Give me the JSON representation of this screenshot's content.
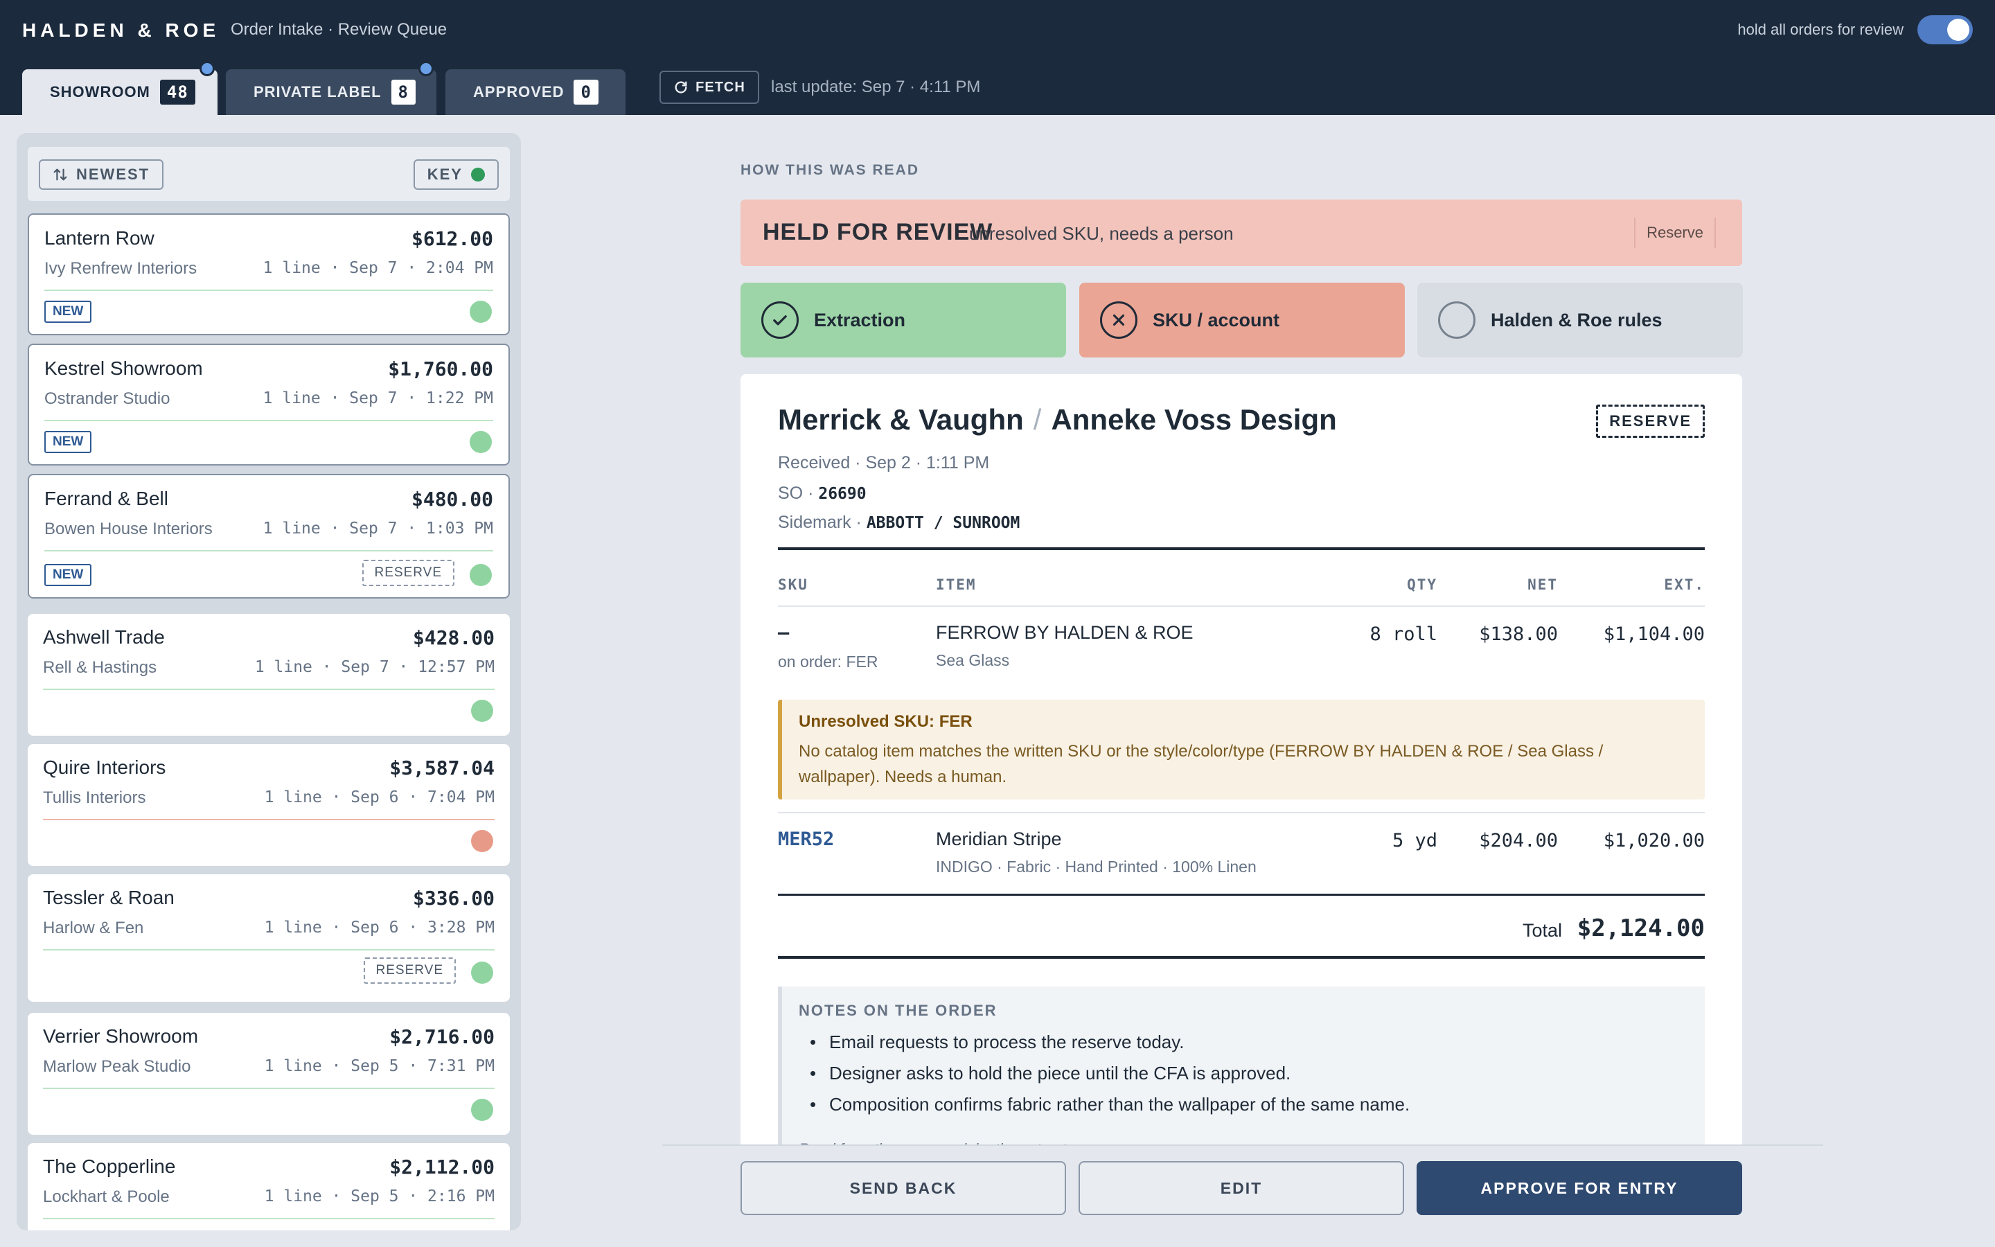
{
  "header": {
    "brand": "HALDEN & ROE",
    "subtitle": "Order Intake · Review Queue",
    "hold_label": "hold all orders for review",
    "hold_enabled": true,
    "tabs": [
      {
        "label": "SHOWROOM",
        "count": "48",
        "active": true,
        "has_dot": true
      },
      {
        "label": "PRIVATE LABEL",
        "count": "8",
        "active": false,
        "has_dot": true
      },
      {
        "label": "APPROVED",
        "count": "0",
        "active": false,
        "has_dot": false
      }
    ],
    "fetch_label": "FETCH",
    "last_update": "last update: Sep 7 · 4:11 PM"
  },
  "sidebar": {
    "sort_label": "NEWEST",
    "key_label": "KEY",
    "cards": [
      {
        "title": "Lantern Row",
        "amount": "$612.00",
        "client": "Ivy Renfrew Interiors",
        "meta": "1 line · Sep 7 · 2:04 PM",
        "badge": "NEW",
        "reserve": "",
        "status": "green"
      },
      {
        "title": "Kestrel Showroom",
        "amount": "$1,760.00",
        "client": "Ostrander Studio",
        "meta": "1 line · Sep 7 · 1:22 PM",
        "badge": "NEW",
        "reserve": "",
        "status": "green"
      },
      {
        "title": "Ferrand & Bell",
        "amount": "$480.00",
        "client": "Bowen House Interiors",
        "meta": "1 line · Sep 7 · 1:03 PM",
        "badge": "NEW",
        "reserve": "RESERVE",
        "status": "green"
      },
      {
        "title": "Ashwell Trade",
        "amount": "$428.00",
        "client": "Rell & Hastings",
        "meta": "1 line · Sep 7 · 12:57 PM",
        "badge": "",
        "reserve": "",
        "status": "green"
      },
      {
        "title": "Quire Interiors",
        "amount": "$3,587.04",
        "client": "Tullis Interiors",
        "meta": "1 line · Sep 6 · 7:04 PM",
        "badge": "",
        "reserve": "",
        "status": "red"
      },
      {
        "title": "Tessler & Roan",
        "amount": "$336.00",
        "client": "Harlow & Fen",
        "meta": "1 line · Sep 6 · 3:28 PM",
        "badge": "",
        "reserve": "RESERVE",
        "status": "green"
      },
      {
        "title": "Verrier Showroom",
        "amount": "$2,716.00",
        "client": "Marlow Peak Studio",
        "meta": "1 line · Sep 5 · 7:31 PM",
        "badge": "",
        "reserve": "",
        "status": "green"
      },
      {
        "title": "The Copperline",
        "amount": "$2,112.00",
        "client": "Lockhart & Poole",
        "meta": "1 line · Sep 5 · 2:16 PM",
        "badge": "",
        "reserve": "",
        "status": "green"
      }
    ]
  },
  "main": {
    "section_label": "HOW THIS WAS READ",
    "held": {
      "title": "HELD FOR REVIEW",
      "reason": "unresolved SKU, needs a person",
      "reserve": "Reserve"
    },
    "checks": [
      {
        "label": "Extraction",
        "state": "ok"
      },
      {
        "label": "SKU / account",
        "state": "bad"
      },
      {
        "label": "Halden & Roe rules",
        "state": "pending"
      }
    ],
    "order": {
      "showroom": "Merrick & Vaughn",
      "designer": "Anneke Voss Design",
      "reserve_tag": "RESERVE",
      "received": "Received · Sep 2 · 1:11 PM",
      "so_label": "SO · ",
      "so_value": "26690",
      "sidemark_label": "Sidemark · ",
      "sidemark_value": "ABBOTT / SUNROOM",
      "columns": {
        "sku": "SKU",
        "item": "ITEM",
        "qty": "QTY",
        "net": "NET",
        "ext": "EXT."
      },
      "lines": [
        {
          "sku": "–",
          "sku_note": "on order: FER",
          "item": "FERROW BY HALDEN & ROE",
          "item_sub": "Sea Glass",
          "qty": "8 roll",
          "net": "$138.00",
          "ext": "$1,104.00"
        },
        {
          "sku": "MER52",
          "sku_note": "",
          "item": "Meridian Stripe",
          "item_sub": "INDIGO · Fabric · Hand Printed · 100% Linen",
          "qty": "5 yd",
          "net": "$204.00",
          "ext": "$1,020.00"
        }
      ],
      "warning": {
        "title": "Unresolved SKU: FER",
        "body": "No catalog item matches the written SKU or the style/color/type (FERROW BY HALDEN & ROE / Sea Glass / wallpaper). Needs a human."
      },
      "total_label": "Total",
      "total_value": "$2,124.00",
      "notes": {
        "title": "NOTES ON THE ORDER",
        "items": [
          "Email requests to process the reserve today.",
          "Designer asks to hold the piece until the CFA is approved.",
          "Composition confirms fabric rather than the wallpaper of the same name."
        ],
        "footer": "Read from the paperwork by the extractor."
      }
    },
    "actions": {
      "send_back": "SEND BACK",
      "edit": "EDIT",
      "approve": "APPROVE FOR ENTRY"
    }
  },
  "colors": {
    "navy": "#1c2a3d",
    "accent": "#4f7cc4",
    "ok": "#9ed5a8",
    "bad": "#eaa595",
    "warn": "#f8f1e4",
    "primary_action": "#2f4a70"
  }
}
